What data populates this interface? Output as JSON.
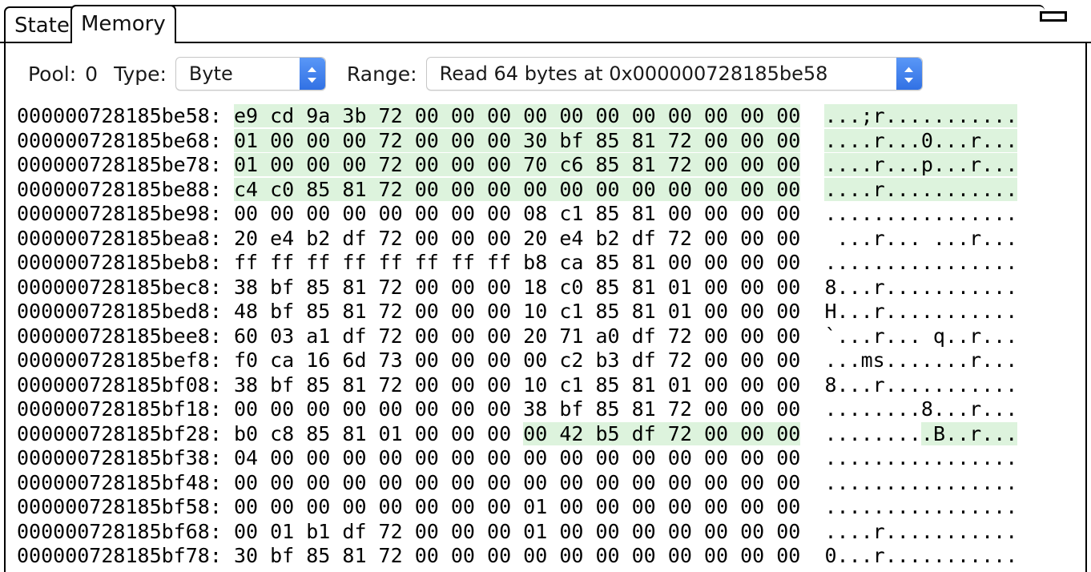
{
  "window": {
    "minimize_icon": "minimize-icon"
  },
  "tabs": [
    {
      "id": "state",
      "label": "State",
      "active": false
    },
    {
      "id": "memory",
      "label": "Memory",
      "active": true
    }
  ],
  "toolbar": {
    "pool_label": "Pool:",
    "pool_value": "0",
    "type_label": "Type:",
    "type_value": "Byte",
    "type_options": [
      "Byte"
    ],
    "range_label": "Range:",
    "range_value": "Read 64 bytes at 0x000000728185be58",
    "range_options": [
      "Read 64 bytes at 0x000000728185be58"
    ],
    "stepper_icon": "chevron-up-down-icon"
  },
  "colors": {
    "highlight": "#ddf3dd",
    "accent": "#2f6fe3",
    "text": "#000000",
    "background": "#ffffff"
  },
  "memory": {
    "bytes_per_row": 16,
    "rows": [
      {
        "address": "000000728185be58",
        "bytes": [
          "e9",
          "cd",
          "9a",
          "3b",
          "72",
          "00",
          "00",
          "00",
          "00",
          "00",
          "00",
          "00",
          "00",
          "00",
          "00",
          "00"
        ],
        "ascii": "...;r...........",
        "highlight": "all"
      },
      {
        "address": "000000728185be68",
        "bytes": [
          "01",
          "00",
          "00",
          "00",
          "72",
          "00",
          "00",
          "00",
          "30",
          "bf",
          "85",
          "81",
          "72",
          "00",
          "00",
          "00"
        ],
        "ascii": "....r...0...r...",
        "highlight": "all"
      },
      {
        "address": "000000728185be78",
        "bytes": [
          "01",
          "00",
          "00",
          "00",
          "72",
          "00",
          "00",
          "00",
          "70",
          "c6",
          "85",
          "81",
          "72",
          "00",
          "00",
          "00"
        ],
        "ascii": "....r...p...r...",
        "highlight": "all"
      },
      {
        "address": "000000728185be88",
        "bytes": [
          "c4",
          "c0",
          "85",
          "81",
          "72",
          "00",
          "00",
          "00",
          "00",
          "00",
          "00",
          "00",
          "00",
          "00",
          "00",
          "00"
        ],
        "ascii": "....r...........",
        "highlight": "all"
      },
      {
        "address": "000000728185be98",
        "bytes": [
          "00",
          "00",
          "00",
          "00",
          "00",
          "00",
          "00",
          "00",
          "08",
          "c1",
          "85",
          "81",
          "00",
          "00",
          "00",
          "00"
        ],
        "ascii": "................",
        "highlight": "none"
      },
      {
        "address": "000000728185bea8",
        "bytes": [
          "20",
          "e4",
          "b2",
          "df",
          "72",
          "00",
          "00",
          "00",
          "20",
          "e4",
          "b2",
          "df",
          "72",
          "00",
          "00",
          "00"
        ],
        "ascii": " ...r... ...r...",
        "highlight": "none"
      },
      {
        "address": "000000728185beb8",
        "bytes": [
          "ff",
          "ff",
          "ff",
          "ff",
          "ff",
          "ff",
          "ff",
          "ff",
          "b8",
          "ca",
          "85",
          "81",
          "00",
          "00",
          "00",
          "00"
        ],
        "ascii": "................",
        "highlight": "none"
      },
      {
        "address": "000000728185bec8",
        "bytes": [
          "38",
          "bf",
          "85",
          "81",
          "72",
          "00",
          "00",
          "00",
          "18",
          "c0",
          "85",
          "81",
          "01",
          "00",
          "00",
          "00"
        ],
        "ascii": "8...r...........",
        "highlight": "none"
      },
      {
        "address": "000000728185bed8",
        "bytes": [
          "48",
          "bf",
          "85",
          "81",
          "72",
          "00",
          "00",
          "00",
          "10",
          "c1",
          "85",
          "81",
          "01",
          "00",
          "00",
          "00"
        ],
        "ascii": "H...r...........",
        "highlight": "none"
      },
      {
        "address": "000000728185bee8",
        "bytes": [
          "60",
          "03",
          "a1",
          "df",
          "72",
          "00",
          "00",
          "00",
          "20",
          "71",
          "a0",
          "df",
          "72",
          "00",
          "00",
          "00"
        ],
        "ascii": "`...r... q..r...",
        "highlight": "none"
      },
      {
        "address": "000000728185bef8",
        "bytes": [
          "f0",
          "ca",
          "16",
          "6d",
          "73",
          "00",
          "00",
          "00",
          "00",
          "c2",
          "b3",
          "df",
          "72",
          "00",
          "00",
          "00"
        ],
        "ascii": "...ms.......r...",
        "highlight": "none"
      },
      {
        "address": "000000728185bf08",
        "bytes": [
          "38",
          "bf",
          "85",
          "81",
          "72",
          "00",
          "00",
          "00",
          "10",
          "c1",
          "85",
          "81",
          "01",
          "00",
          "00",
          "00"
        ],
        "ascii": "8...r...........",
        "highlight": "none"
      },
      {
        "address": "000000728185bf18",
        "bytes": [
          "00",
          "00",
          "00",
          "00",
          "00",
          "00",
          "00",
          "00",
          "38",
          "bf",
          "85",
          "81",
          "72",
          "00",
          "00",
          "00"
        ],
        "ascii": "........8...r...",
        "highlight": "none"
      },
      {
        "address": "000000728185bf28",
        "bytes": [
          "b0",
          "c8",
          "85",
          "81",
          "01",
          "00",
          "00",
          "00",
          "00",
          "42",
          "b5",
          "df",
          "72",
          "00",
          "00",
          "00"
        ],
        "ascii": ".........B..r...",
        "highlight": "second-half"
      },
      {
        "address": "000000728185bf38",
        "bytes": [
          "04",
          "00",
          "00",
          "00",
          "00",
          "00",
          "00",
          "00",
          "00",
          "00",
          "00",
          "00",
          "00",
          "00",
          "00",
          "00"
        ],
        "ascii": "................",
        "highlight": "none"
      },
      {
        "address": "000000728185bf48",
        "bytes": [
          "00",
          "00",
          "00",
          "00",
          "00",
          "00",
          "00",
          "00",
          "00",
          "00",
          "00",
          "00",
          "00",
          "00",
          "00",
          "00"
        ],
        "ascii": "................",
        "highlight": "none"
      },
      {
        "address": "000000728185bf58",
        "bytes": [
          "00",
          "00",
          "00",
          "00",
          "00",
          "00",
          "00",
          "00",
          "01",
          "00",
          "00",
          "00",
          "00",
          "00",
          "00",
          "00"
        ],
        "ascii": "................",
        "highlight": "none"
      },
      {
        "address": "000000728185bf68",
        "bytes": [
          "00",
          "01",
          "b1",
          "df",
          "72",
          "00",
          "00",
          "00",
          "01",
          "00",
          "00",
          "00",
          "00",
          "00",
          "00",
          "00"
        ],
        "ascii": "....r...........",
        "highlight": "none"
      },
      {
        "address": "000000728185bf78",
        "bytes": [
          "30",
          "bf",
          "85",
          "81",
          "72",
          "00",
          "00",
          "00",
          "00",
          "00",
          "00",
          "00",
          "00",
          "00",
          "00",
          "00"
        ],
        "ascii": "0...r...........",
        "highlight": "none"
      }
    ]
  }
}
